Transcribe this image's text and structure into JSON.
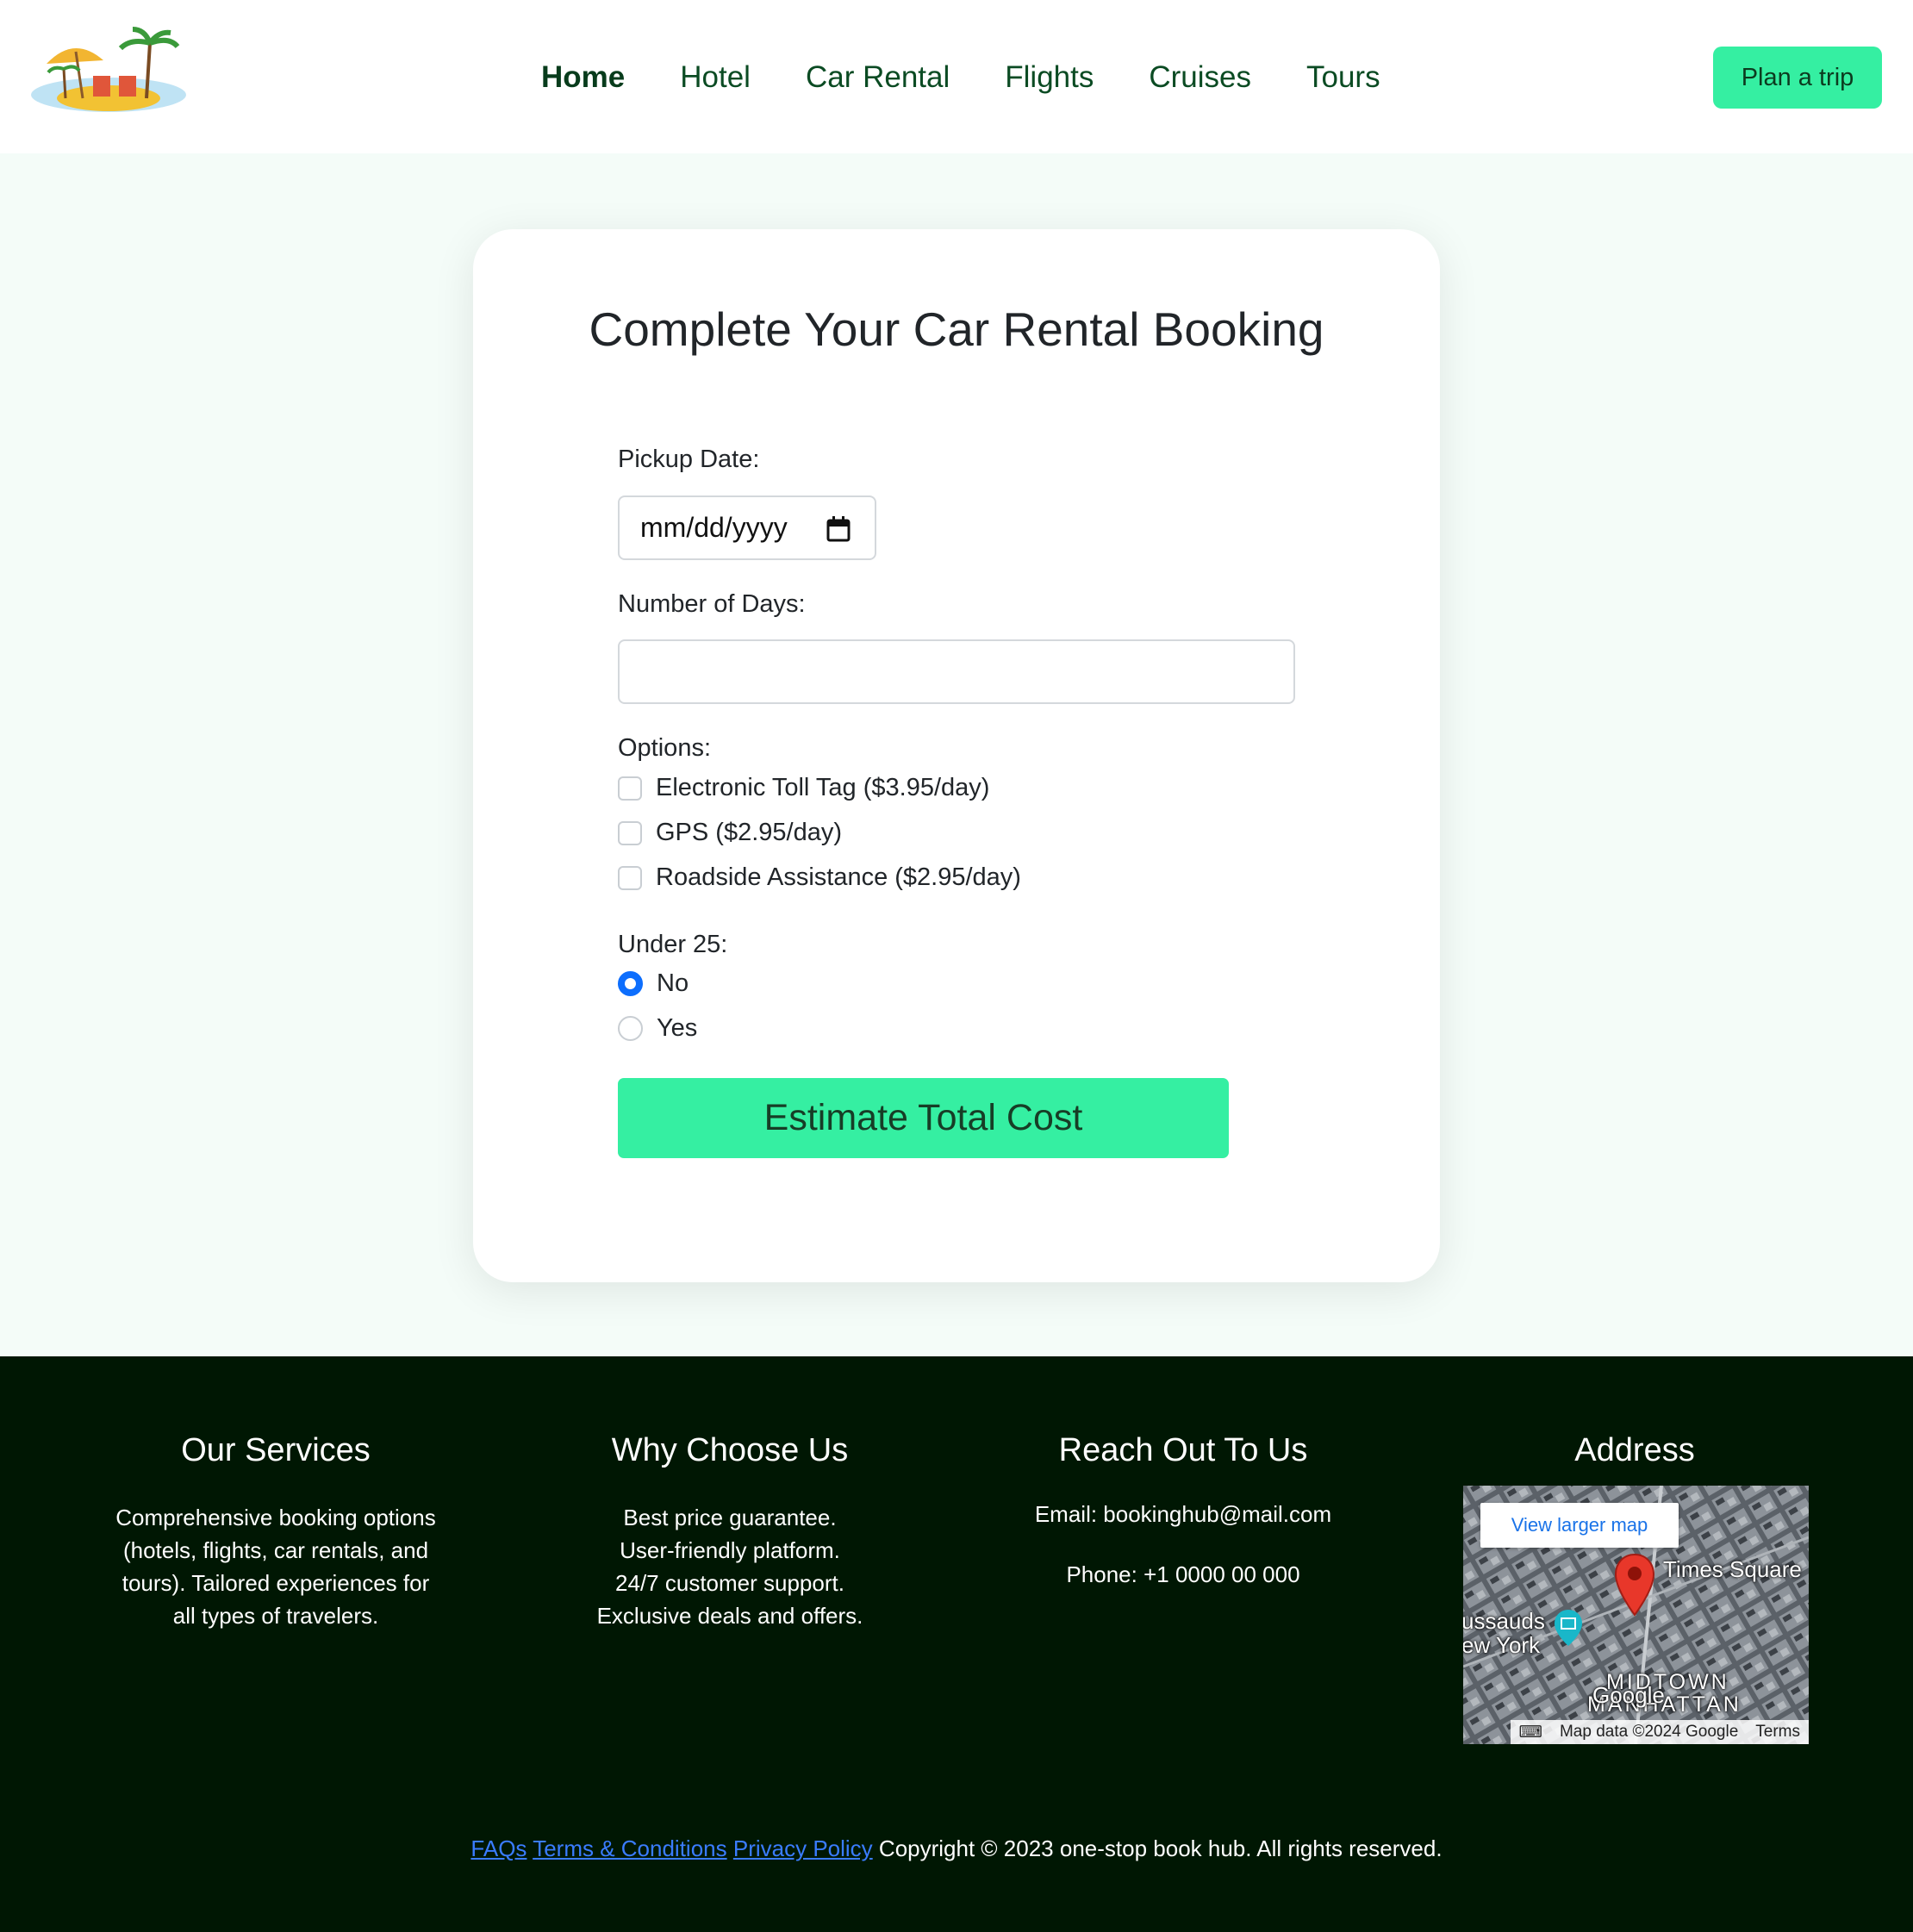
{
  "nav": {
    "items": [
      {
        "label": "Home",
        "active": true
      },
      {
        "label": "Hotel"
      },
      {
        "label": "Car Rental"
      },
      {
        "label": "Flights"
      },
      {
        "label": "Cruises"
      },
      {
        "label": "Tours"
      }
    ],
    "plan_button": "Plan a trip"
  },
  "booking": {
    "title": "Complete Your Car Rental Booking",
    "pickup_label": "Pickup Date:",
    "pickup_placeholder": "mm/dd/yyyy",
    "days_label": "Number of Days:",
    "days_value": "",
    "options_label": "Options:",
    "options": [
      {
        "label": "Electronic Toll Tag ($3.95/day)",
        "checked": false
      },
      {
        "label": "GPS ($2.95/day)",
        "checked": false
      },
      {
        "label": "Roadside Assistance ($2.95/day)",
        "checked": false
      }
    ],
    "under25_label": "Under 25:",
    "under25_choices": [
      {
        "label": "No",
        "selected": true
      },
      {
        "label": "Yes",
        "selected": false
      }
    ],
    "estimate_button": "Estimate Total Cost"
  },
  "footer": {
    "services": {
      "title": "Our Services",
      "lines": [
        "Comprehensive booking options",
        "(hotels, flights, car rentals, and",
        "tours). Tailored experiences for",
        "all types of travelers."
      ]
    },
    "why": {
      "title": "Why Choose Us",
      "lines": [
        "Best price guarantee.",
        "User-friendly platform.",
        "24/7 customer support.",
        "Exclusive deals and offers."
      ]
    },
    "reach": {
      "title": "Reach Out To Us",
      "email": "Email: bookinghub@mail.com",
      "phone": "Phone: +1 0000 00 000"
    },
    "address": {
      "title": "Address",
      "map_button": "View larger map",
      "map_labels": [
        "Times Square",
        "ussauds",
        "ew York",
        "MIDTOWN",
        "MANHATTAN",
        "Google"
      ],
      "map_footer": [
        "Map data ©2024 Google",
        "Terms"
      ]
    },
    "links": [
      "FAQs",
      "Terms & Conditions",
      "Privacy Policy"
    ],
    "copyright": "Copyright © 2023 one-stop book hub. All rights reserved."
  },
  "colors": {
    "accent": "#35efa2",
    "nav_text": "#0b4b23",
    "footer_bg": "#001703",
    "page_bg": "#f4fcf8",
    "radio_selected": "#0d6efd",
    "link": "#3a7cff"
  },
  "icons": {
    "logo": "beach-umbrella-palm-logo",
    "date": "calendar-icon",
    "map_pin": "map-pin-icon"
  }
}
